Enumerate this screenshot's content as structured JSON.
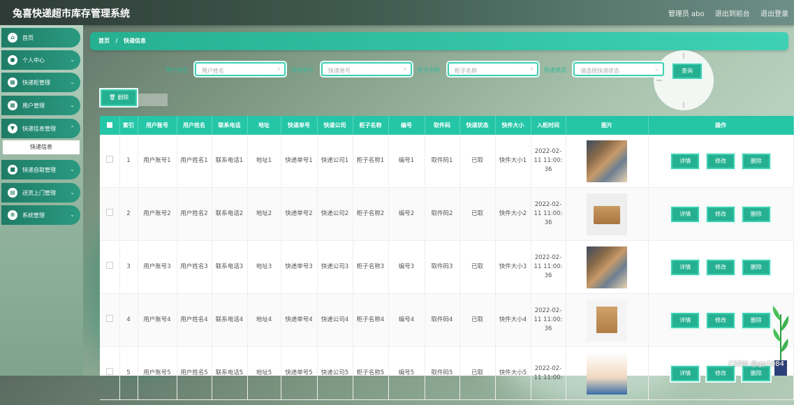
{
  "app": {
    "title": "兔喜快递超市库存管理系统"
  },
  "topbar": {
    "admin": "管理员 abo",
    "goto_frontend": "退出到前台",
    "logout": "退出登录"
  },
  "sidebar": {
    "items": [
      {
        "label": "首页",
        "icon": "home-icon"
      },
      {
        "label": "个人中心",
        "icon": "user-icon"
      },
      {
        "label": "快递柜管理",
        "icon": "grid-icon"
      },
      {
        "label": "用户管理",
        "icon": "grid-icon"
      },
      {
        "label": "快递信息管理",
        "icon": "shield-icon"
      },
      {
        "label": "快递自取管理",
        "icon": "box-icon"
      },
      {
        "label": "送货上门管理",
        "icon": "doc-icon"
      },
      {
        "label": "系统管理",
        "icon": "menu-icon"
      }
    ],
    "sub_active": "快递信息"
  },
  "breadcrumb": {
    "home": "首页",
    "sep": "/",
    "current": "快递信息"
  },
  "search": {
    "username_label": "用户姓名",
    "username_placeholder": "用户姓名",
    "tracking_label": "快递单号",
    "tracking_placeholder": "快递单号",
    "cabinet_label": "柜子名称",
    "cabinet_placeholder": "柜子名称",
    "status_label": "快递状态",
    "status_placeholder": "请选择快递状态",
    "button": "查询"
  },
  "toolbar": {
    "delete": "删除"
  },
  "table": {
    "headers": [
      "索引",
      "用户账号",
      "用户姓名",
      "联系电话",
      "地址",
      "快递单号",
      "快递公司",
      "柜子名称",
      "编号",
      "取件码",
      "快递状态",
      "快件大小",
      "入柜时间",
      "图片",
      "操作"
    ],
    "rows": [
      {
        "idx": "1",
        "account": "用户账号1",
        "name": "用户姓名1",
        "phone": "联系电话1",
        "addr": "地址1",
        "tracking": "快递单号1",
        "company": "快递公司1",
        "cabinet": "柜子名称1",
        "no": "编号1",
        "code": "取件码1",
        "status": "已取",
        "size": "快件大小1",
        "time": "2022-02-11 11:00:36",
        "img": "pkgs"
      },
      {
        "idx": "2",
        "account": "用户账号2",
        "name": "用户姓名2",
        "phone": "联系电话2",
        "addr": "地址2",
        "tracking": "快递单号2",
        "company": "快递公司2",
        "cabinet": "柜子名称2",
        "no": "编号2",
        "code": "取件码2",
        "status": "已取",
        "size": "快件大小2",
        "time": "2022-02-11 11:00:36",
        "img": "box"
      },
      {
        "idx": "3",
        "account": "用户账号3",
        "name": "用户姓名3",
        "phone": "联系电话3",
        "addr": "地址3",
        "tracking": "快递单号3",
        "company": "快递公司3",
        "cabinet": "柜子名称3",
        "no": "编号3",
        "code": "取件码3",
        "status": "已取",
        "size": "快件大小3",
        "time": "2022-02-11 11:00:36",
        "img": "pkgs"
      },
      {
        "idx": "4",
        "account": "用户账号4",
        "name": "用户姓名4",
        "phone": "联系电话4",
        "addr": "地址4",
        "tracking": "快递单号4",
        "company": "快递公司4",
        "cabinet": "柜子名称4",
        "no": "编号4",
        "code": "取件码4",
        "status": "已取",
        "size": "快件大小4",
        "time": "2022-02-11 11:00:36",
        "img": "box2"
      },
      {
        "idx": "5",
        "account": "用户账号5",
        "name": "用户姓名5",
        "phone": "联系电话5",
        "addr": "地址5",
        "tracking": "快递单号5",
        "company": "快递公司5",
        "cabinet": "柜子名称5",
        "no": "编号5",
        "code": "取件码5",
        "status": "已取",
        "size": "快件大小5",
        "time": "2022-02-11 11:00:",
        "img": "person"
      }
    ],
    "actions": {
      "detail": "详情",
      "edit": "修改",
      "delete": "删除"
    }
  },
  "watermark": "CSDN @gp1084",
  "colors": {
    "accent": "#25b091",
    "header_row": "#25c6a8"
  }
}
